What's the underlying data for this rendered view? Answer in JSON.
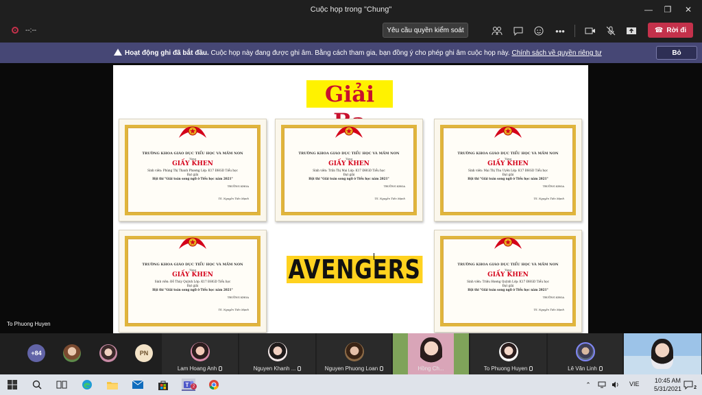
{
  "window": {
    "title": "Cuộc họp trong \"Chung\""
  },
  "toolbar": {
    "rec_time": "--:--",
    "request_control_label": "Yêu cầu quyền kiểm soát",
    "leave_label": "Rời đi"
  },
  "banner": {
    "bold": "Hoạt động ghi đã bắt đầu.",
    "text": " Cuộc họp này đang được ghi âm. Bằng cách tham gia, bạn đồng ý cho phép ghi âm cuộc họp này. ",
    "link": "Chính sách về quyền riêng tư",
    "dismiss_label": "Bỏ"
  },
  "slide": {
    "title": "Giải Ba",
    "caption": "AVENGERS",
    "certificate_common": {
      "school": "TRƯỜNG KHOA GIÁO DỤC TIỂU HỌC VÀ MẦM NON",
      "tang": "Tặng",
      "heading": "GIẤY KHEN",
      "dat_giai": "Đạt giải",
      "contest": "Hội thi \"Giải toán song ngữ ở Tiểu học năm 2021\"",
      "signer_title": "TRƯỞNG KHOA",
      "signer": "TS. Nguyễn Tiến Mạnh"
    },
    "certificates": [
      {
        "recipient": "Sinh viên: Phùng Thị Thanh Phương  Lớp: K17 ĐHGD Tiểu học"
      },
      {
        "recipient": "Sinh viên: Trần Thị Mai  Lớp: K17 ĐHGD Tiểu học"
      },
      {
        "recipient": "Sinh viên: Mai Thị Thu Uyên  Lớp: K17 ĐHGD Tiểu học"
      },
      {
        "recipient": "Sinh viên: Đỗ Thúy Quỳnh  Lớp: K17 ĐHGD Tiểu học"
      },
      {
        "recipient": "Sinh viên: Triệu Hương Quỳnh  Lớp: K17 ĐHGD Tiểu học"
      }
    ]
  },
  "stage": {
    "presenter_name": "To Phuong Huyen"
  },
  "gallery": {
    "overflow_count": "+84",
    "initials_avatar": "PN",
    "participants": [
      {
        "name": "Lam Hoang Anh"
      },
      {
        "name": "Nguyen Khanh ..."
      },
      {
        "name": "Nguyen Phuong Loan"
      },
      {
        "name": "Hồng Ch..."
      },
      {
        "name": "To Phuong Huyen"
      },
      {
        "name": "Lê Văn Linh"
      }
    ]
  },
  "taskbar": {
    "lang": "VIE",
    "time": "10:45 AM",
    "date": "5/31/2021",
    "notification_count": "2"
  },
  "colors": {
    "banner": "#464775",
    "leave": "#c4314b",
    "title_bg": "#fff200",
    "title_fg": "#c8102e"
  }
}
